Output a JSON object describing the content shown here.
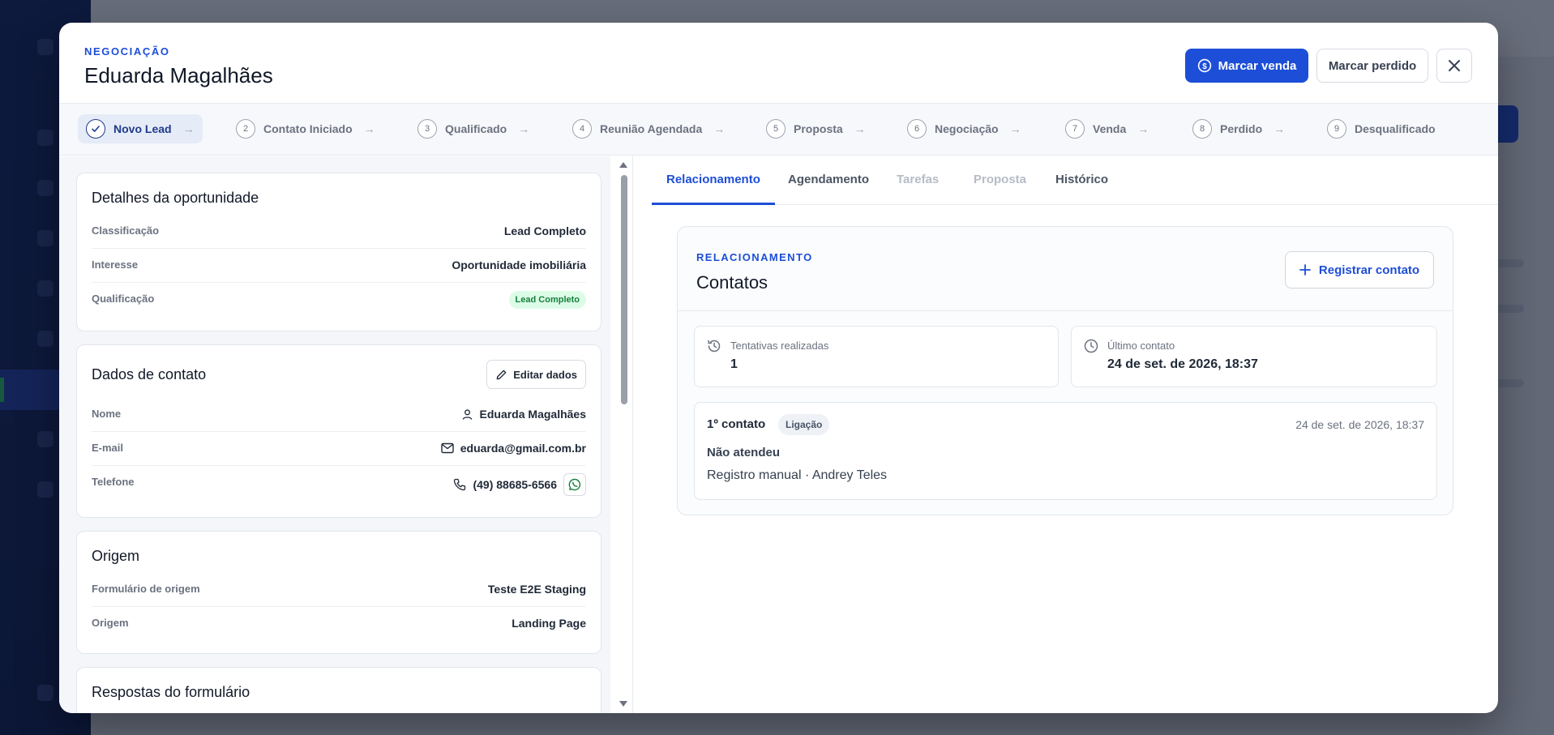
{
  "header": {
    "eyebrow": "NEGOCIAÇÃO",
    "title": "Eduarda Magalhães",
    "sale_label": "Marcar venda",
    "lost_label": "Marcar perdido"
  },
  "steps": [
    {
      "num": "",
      "label": "Novo Lead",
      "current": true
    },
    {
      "num": "2",
      "label": "Contato Iniciado"
    },
    {
      "num": "3",
      "label": "Qualificado"
    },
    {
      "num": "4",
      "label": "Reunião Agendada"
    },
    {
      "num": "5",
      "label": "Proposta"
    },
    {
      "num": "6",
      "label": "Negociação"
    },
    {
      "num": "7",
      "label": "Venda"
    },
    {
      "num": "8",
      "label": "Perdido"
    },
    {
      "num": "9",
      "label": "Desqualificado"
    }
  ],
  "details": {
    "title": "Detalhes da oportunidade",
    "rows": [
      {
        "k": "Classificação",
        "v": "Lead Completo"
      },
      {
        "k": "Interesse",
        "v": "Oportunidade imobiliária"
      },
      {
        "k": "Qualificação",
        "v": "Lead Completo"
      }
    ]
  },
  "contact": {
    "title": "Dados de contato",
    "edit_label": "Editar dados",
    "rows": [
      {
        "k": "Nome",
        "v": "Eduarda Magalhães"
      },
      {
        "k": "E-mail",
        "v": "eduarda@gmail.com.br"
      },
      {
        "k": "Telefone",
        "v": "(49) 88685-6566"
      }
    ]
  },
  "origin": {
    "title": "Origem",
    "rows": [
      {
        "k": "Formulário de origem",
        "v": "Teste E2E Staging"
      },
      {
        "k": "Origem",
        "v": "Landing Page"
      }
    ]
  },
  "answers": {
    "title": "Respostas do formulário"
  },
  "tabs": [
    {
      "label": "Relacionamento",
      "state": "active"
    },
    {
      "label": "Agendamento",
      "state": "normal"
    },
    {
      "label": "Tarefas",
      "state": "disabled"
    },
    {
      "label": "Proposta",
      "state": "disabled"
    },
    {
      "label": "Histórico",
      "state": "normal"
    }
  ],
  "panel": {
    "eyebrow": "RELACIONAMENTO",
    "title": "Contatos",
    "register_label": "Registrar contato",
    "attempts_label": "Tentativas realizadas",
    "attempts_value": "1",
    "last_label": "Último contato",
    "last_value": "24 de set. de 2026, 18:37",
    "entry": {
      "title": "1º contato",
      "chip": "Ligação",
      "time": "24 de set. de 2026, 18:37",
      "status": "Não atendeu",
      "meta": "Registro manual · Andrey Teles"
    }
  },
  "colors": {
    "accent": "#1d4ed8",
    "success": "#15803d"
  }
}
